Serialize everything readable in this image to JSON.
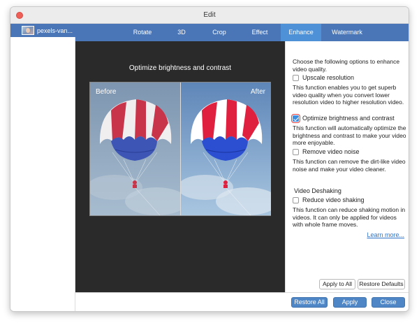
{
  "window": {
    "title": "Edit"
  },
  "sidebar": {
    "file_name": "pexels-van..."
  },
  "tabs": [
    {
      "label": "Rotate",
      "active": false
    },
    {
      "label": "3D",
      "active": false
    },
    {
      "label": "Crop",
      "active": false
    },
    {
      "label": "Effect",
      "active": false
    },
    {
      "label": "Enhance",
      "active": true
    },
    {
      "label": "Watermark",
      "active": false
    }
  ],
  "preview": {
    "title": "Optimize brightness and contrast",
    "before_label": "Before",
    "after_label": "After"
  },
  "options": {
    "intro": "Choose the following options to enhance video quality.",
    "upscale": {
      "label": "Upscale resolution",
      "checked": false,
      "desc": "This function enables you to get superb video quality when you convert lower resolution video to higher resolution video."
    },
    "brightness": {
      "label": "Optimize brightness and contrast",
      "checked": true,
      "desc": "This function will automatically optimize the brightness and contrast to make your video more enjoyable."
    },
    "noise": {
      "label": "Remove video noise",
      "checked": false,
      "desc": "This function can remove the dirt-like video noise and make your video cleaner."
    },
    "deshaking_header": "Video Deshaking",
    "shaking": {
      "label": "Reduce video shaking",
      "checked": false,
      "desc": "This function can reduce shaking motion in videos. It can only be applied for videos with whole frame moves."
    },
    "learn_more": "Learn more..."
  },
  "buttons": {
    "apply_to_all": "Apply to All",
    "restore_defaults": "Restore Defaults",
    "restore_all": "Restore All",
    "apply": "Apply",
    "close": "Close"
  },
  "colors": {
    "tabbar": "#4a76b8",
    "active_tab": "#4f91d6",
    "button": "#4f86c6",
    "link": "#2f73c9"
  }
}
